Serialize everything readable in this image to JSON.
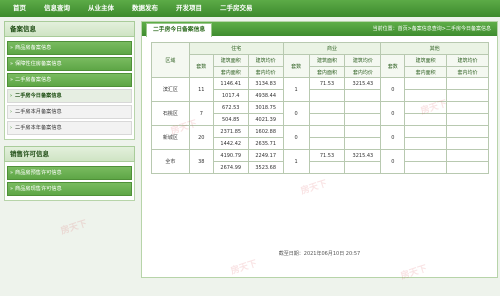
{
  "nav": {
    "items": [
      "首页",
      "信息查询",
      "从业主体",
      "数据发布",
      "开发项目",
      "二手房交易"
    ]
  },
  "sidebar": {
    "section1_title": "备案信息",
    "section1_items": [
      {
        "label": "商品房备案信息"
      },
      {
        "label": "保障性住房备案信息"
      },
      {
        "label": "二手房备案信息"
      }
    ],
    "section1_subitems": [
      {
        "label": "二手房今日备案信息"
      },
      {
        "label": "二手房本月备案信息"
      },
      {
        "label": "二手房本年备案信息"
      }
    ],
    "section2_title": "销售许可信息",
    "section2_items": [
      {
        "label": "商品房预售许可信息"
      },
      {
        "label": "商品房现售许可信息"
      }
    ]
  },
  "main": {
    "tab_title": "二手房今日备案信息",
    "breadcrumb": "当前位置：首页>备案信息查询>二手房今日备案信息",
    "headers": {
      "district": "区域",
      "residential": "住宅",
      "commercial": "商业",
      "other": "其他",
      "units": "套数",
      "build_area": "建筑面积",
      "build_price": "建筑均价",
      "inner_area": "套内面积",
      "inner_price": "套内均价"
    },
    "rows": [
      {
        "district": "滨汇区",
        "res_units": "11",
        "res_area": "1146.41",
        "res_price": "3134.83",
        "res_inner_area": "1017.4",
        "res_inner_price": "4938.44",
        "com_units": "1",
        "com_area": "71.53",
        "com_price": "3215.43",
        "oth_units": "0"
      },
      {
        "district": "石桃区",
        "res_units": "7",
        "res_area": "672.53",
        "res_price": "3018.75",
        "res_inner_area": "504.85",
        "res_inner_price": "4021.39",
        "com_units": "0",
        "com_area": "",
        "com_price": "",
        "oth_units": "0"
      },
      {
        "district": "新城区",
        "res_units": "20",
        "res_area": "2371.85",
        "res_price": "1602.88",
        "res_inner_area": "1442.42",
        "res_inner_price": "2635.71",
        "com_units": "0",
        "com_area": "",
        "com_price": "",
        "oth_units": "0"
      },
      {
        "district": "全市",
        "res_units": "38",
        "res_area": "4190.79",
        "res_price": "2249.17",
        "res_inner_area": "2674.99",
        "res_inner_price": "3523.68",
        "com_units": "1",
        "com_area": "71.53",
        "com_price": "3215.43",
        "oth_units": "0"
      }
    ],
    "footer": "截至日期：2021年06月10日 20:57"
  },
  "watermark": "房天下",
  "colors": {
    "primary_green": "#4a9a36",
    "background": "#eef3ec"
  }
}
